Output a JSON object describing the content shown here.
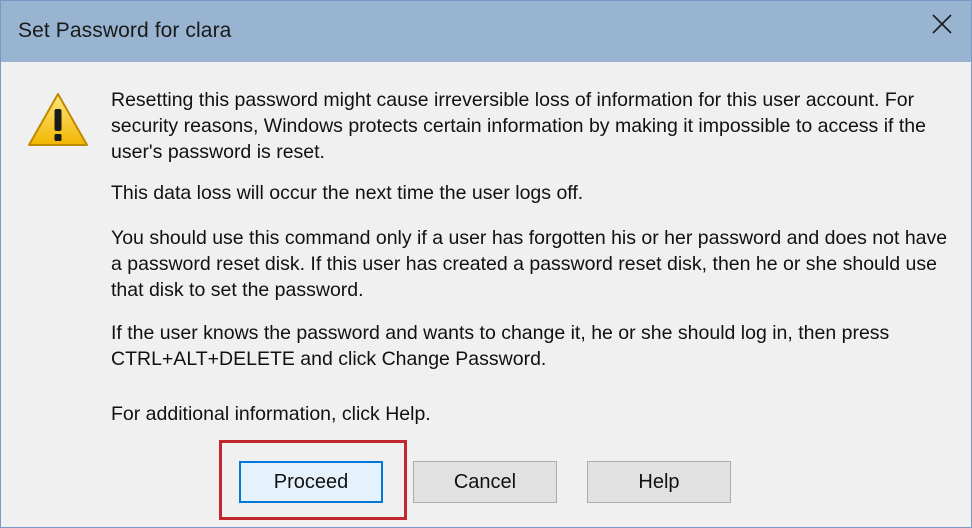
{
  "window": {
    "title": "Set Password for clara"
  },
  "message": {
    "paragraph1": "Resetting this password might cause irreversible loss of information for this user account. For security reasons, Windows protects certain information by making it impossible to access if the user's password is reset.",
    "paragraph2": "This data loss will occur the next time the user logs off.",
    "paragraph3": "You should use this command only if a user has forgotten his or her password and does not have a password reset disk. If this user has created a password reset disk, then he or she should use that disk to set the password.",
    "paragraph4": "If the user knows the password and wants to change it, he or she should log in, then press CTRL+ALT+DELETE and click Change Password.",
    "paragraph5": "For additional information, click Help."
  },
  "buttons": {
    "proceed": "Proceed",
    "cancel": "Cancel",
    "help": "Help"
  },
  "icons": {
    "warning": "warning-icon",
    "close": "close-icon"
  },
  "colors": {
    "titlebar": "#99b4d1",
    "dialog_bg": "#f0f0f0",
    "default_button_border": "#0078d7",
    "highlight": "#c0282e",
    "warning_yellow": "#f5c518"
  }
}
